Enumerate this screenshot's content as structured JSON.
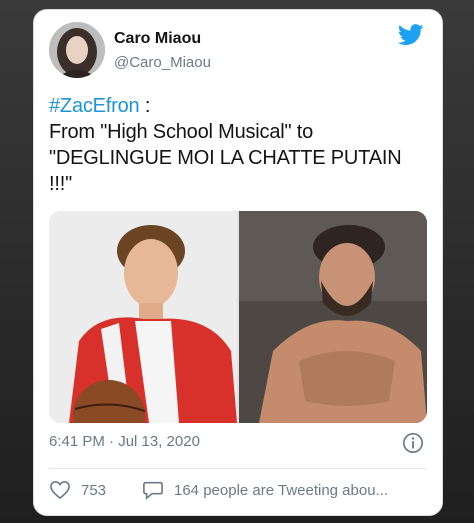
{
  "author": {
    "name": "Caro Miaou",
    "handle": "@Caro_Miaou",
    "avatar_icon": "profile-photo"
  },
  "tweet": {
    "hashtag": "#ZacEfron",
    "hashtag_suffix": " :",
    "line2": "From \"High School Musical\" to",
    "line3": "\"DEGLINGUE MOI LA CHATTE PUTAIN",
    "line4": "!!!\""
  },
  "media": {
    "left_image": "young man in red jacket holding basketball",
    "right_image": "shirtless bearded man"
  },
  "meta": {
    "timestamp": "6:41 PM · Jul 13, 2020"
  },
  "engagement": {
    "likes": "753",
    "replies_text": "164 people are Tweeting abou..."
  },
  "colors": {
    "link": "#1d95d6",
    "secondary_text": "#6b7a86",
    "twitter_blue": "#1da1f2"
  }
}
